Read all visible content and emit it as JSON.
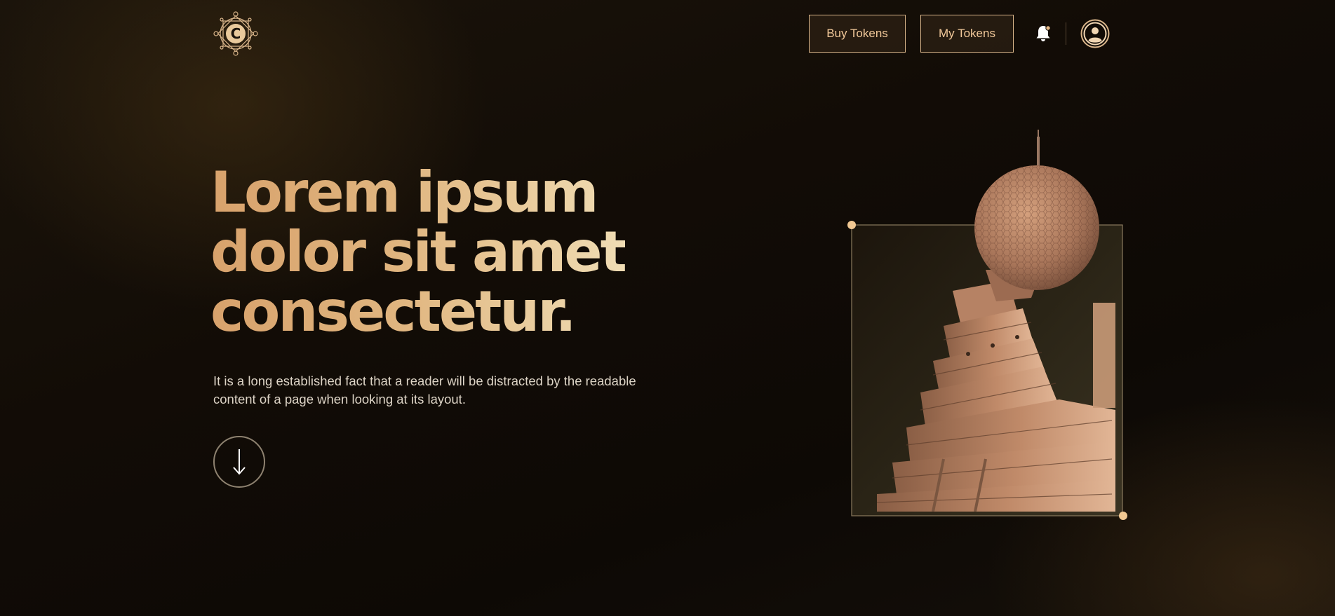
{
  "header": {
    "buy_tokens_label": "Buy Tokens",
    "my_tokens_label": "My Tokens",
    "logo_letter": "C",
    "icons": {
      "logo": "ornate-c-logo-icon",
      "notifications": "bell-icon",
      "profile": "user-circle-icon"
    }
  },
  "hero": {
    "title_lines": [
      "Lorem ipsum",
      "dolor sit amet",
      "consectetur."
    ],
    "description": "It is a long established fact that a reader will be distracted by the readable content of a page when looking at its layout.",
    "scroll_icon": "arrow-down-icon"
  },
  "colors": {
    "background": "#120c06",
    "accent_gold": "#d9b58a",
    "title_gradient_start": "#d8a26c",
    "title_gradient_end": "#f0ddb4",
    "body_text": "#ddd4c6"
  }
}
